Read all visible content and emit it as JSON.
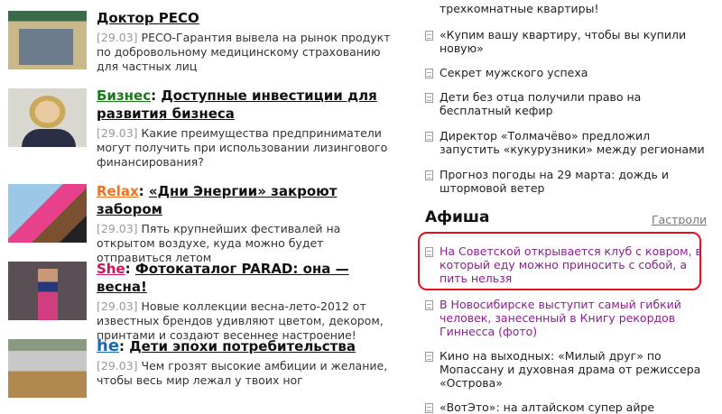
{
  "articles": [
    {
      "rubric": "",
      "title": "Доктор РЕСО",
      "date": "[29.03]",
      "text": "РЕСО-Гарантия вывела на рынок продукт по добровольному медицинскому страхованию для частных лиц"
    },
    {
      "rubric": "Бизнес",
      "rubric_color": "#1a7a1a",
      "title": "Доступные инвестиции для развития бизнеса",
      "date": "[29.03]",
      "text": "Какие преимущества предприниматели могут получить при использовании лизингового финансирования?"
    },
    {
      "rubric": "Relax",
      "rubric_color": "#f07020",
      "title": "«Дни Энергии» закроют забором",
      "date": "[29.03]",
      "text": "Пять крупнейших фестивалей на открытом воздухе, куда можно будет отправиться летом"
    },
    {
      "rubric": "She",
      "rubric_color": "#d0105a",
      "title": "Фотокаталог PARAD: она — весна!",
      "date": "[29.03]",
      "text": "Новые коллекции весна-лето-2012 от известных брендов удивляют цветом, декором, принтами и создают весеннее настроение!"
    },
    {
      "rubric": "he",
      "rubric_color": "#1a6cb0",
      "title": "Дети эпохи потребительства",
      "date": "[29.03]",
      "text": "Чем грозят высокие амбиции и желание, чтобы весь мир лежал у твоих ног"
    }
  ],
  "news": [
    "трехкомнатные квартиры!",
    "«Купим вашу квартиру, чтобы вы купили новую»",
    "Секрет мужского успеха",
    "Дети без отца получили право на бесплатный кефир",
    "Директор «Толмачёво» предложил запустить «кукурузники» между регионами",
    "Прогноз погоды на 29 марта: дождь и штормовой ветер"
  ],
  "afisha": {
    "title": "Афиша",
    "link": "Гастроли",
    "items": [
      "На Советской открывается клуб с ковром, в который еду можно приносить с собой, а пить нельзя",
      "В Новосибирске выступит самый гибкий человек, занесенный в Книгу рекордов Гиннесса (фото)",
      "Кино на выходных: «Милый друг» по Мопассану и духовная драма от режиссера «Острова»",
      "«ВотЭто»: на алтайском супер айре"
    ]
  },
  "colors": {
    "highlight": "#e8101a",
    "visited": "#8a1f8f"
  }
}
